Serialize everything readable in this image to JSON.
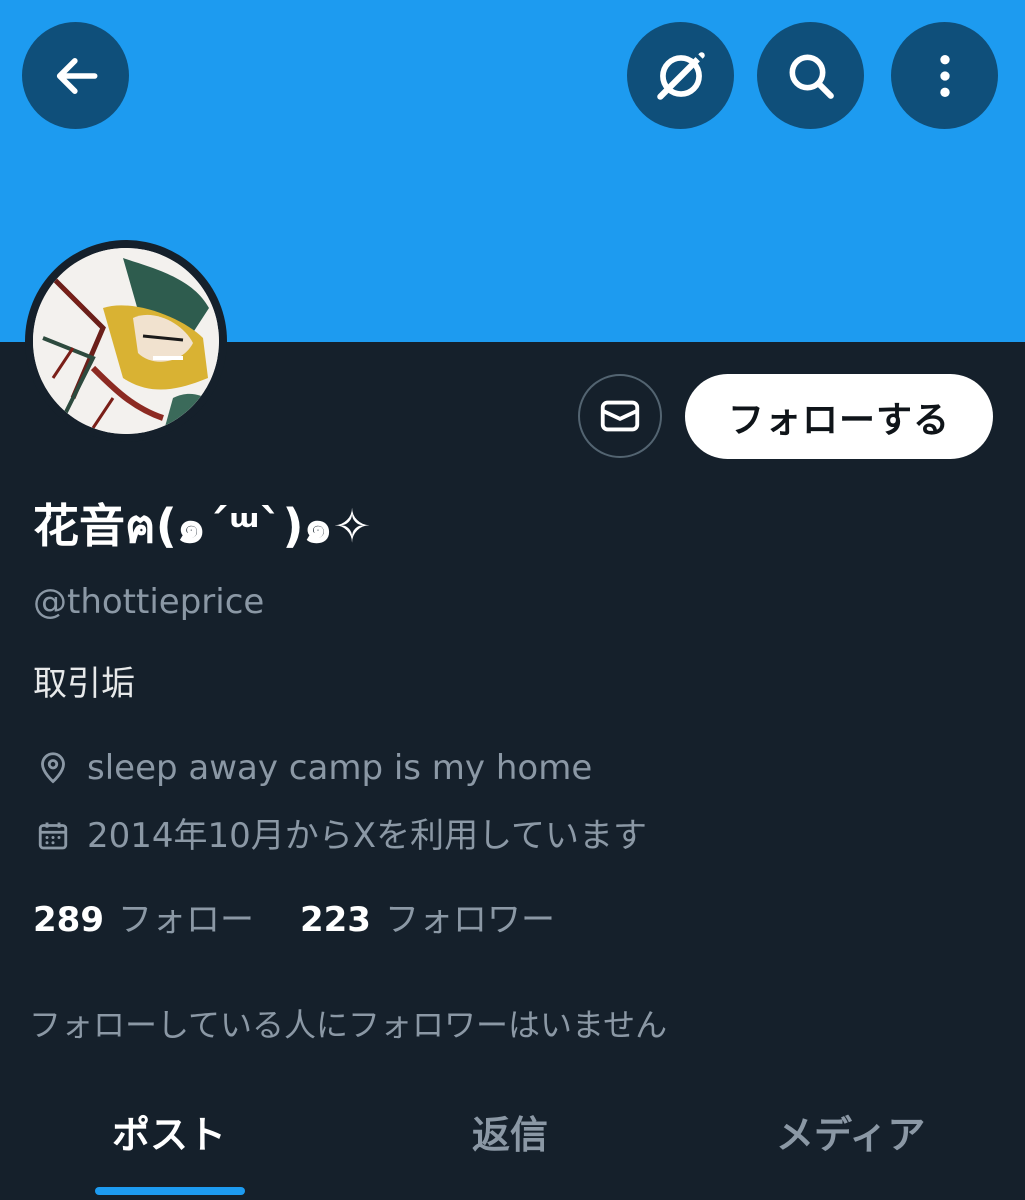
{
  "colors": {
    "banner": "#1d9bf0",
    "background": "#15202b",
    "accent": "#1d9bf0",
    "button_dark": "#0f4f7a",
    "text_primary": "#ffffff",
    "text_secondary": "#8b98a5"
  },
  "topbar": {
    "back_icon": "arrow-left-icon",
    "grok_icon": "grok-icon",
    "search_icon": "search-icon",
    "more_icon": "more-vertical-icon"
  },
  "profile": {
    "display_name": "花音ฅ(๑´ᵚ`)๑✧",
    "handle": "@thottieprice",
    "bio": "取引垢",
    "location": "sleep away camp is my home",
    "joined": "2014年10月からXを利用しています",
    "location_icon": "location-pin-icon",
    "calendar_icon": "calendar-icon"
  },
  "actions": {
    "message_icon": "mail-icon",
    "follow_label": "フォローする"
  },
  "stats": {
    "following_count": "289",
    "following_label": "フォロー",
    "followers_count": "223",
    "followers_label": "フォロワー"
  },
  "followers_you_know": "フォローしている人にフォロワーはいません",
  "tabs": [
    {
      "label": "ポスト",
      "active": true
    },
    {
      "label": "返信",
      "active": false
    },
    {
      "label": "メディア",
      "active": false
    }
  ]
}
